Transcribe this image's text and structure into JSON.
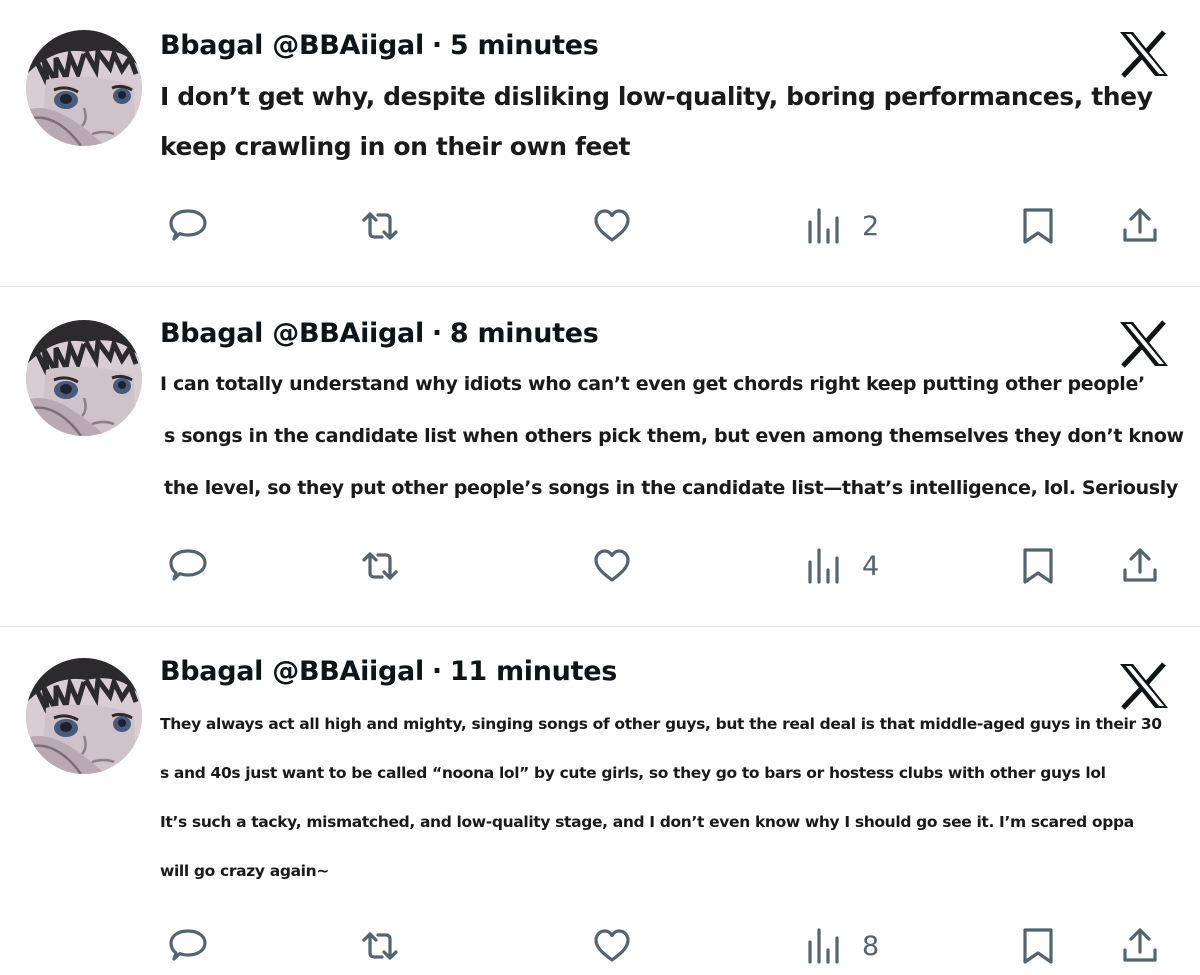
{
  "tweets": [
    {
      "display_name": "Bbagal",
      "handle": "@BBAiigal",
      "separator": "·",
      "time": "5 minutes",
      "lines": [
        "I don’t get why, despite disliking low-quality, boring performances, they",
        "keep crawling in on their own feet"
      ],
      "views": "2"
    },
    {
      "display_name": "Bbagal",
      "handle": "@BBAiigal",
      "separator": "·",
      "time": "8 minutes",
      "lines": [
        "I can totally understand why idiots who can’t even get chords right keep putting other people’",
        "s songs in the candidate list when others pick them, but even among themselves they don’t know",
        "the level, so they put other people’s songs in the candidate list—that’s intelligence, lol. Seriously"
      ],
      "views": "4"
    },
    {
      "display_name": "Bbagal",
      "handle": "@BBAiigal",
      "separator": "·",
      "time": "11 minutes",
      "lines": [
        "They always act all high and mighty, singing songs of other guys, but the real deal is that middle-aged guys in their 30",
        "s and 40s just want to be called “noona lol” by cute girls, so they go to bars or hostess clubs with other guys lol",
        "It’s such a tacky, mismatched, and low-quality stage, and I don’t even know why I should go see it. I’m scared oppa",
        "will go crazy again~"
      ],
      "views": "8"
    }
  ],
  "icons": {
    "logo": "x-logo-icon",
    "reply": "reply-icon",
    "retweet": "retweet-icon",
    "like": "heart-icon",
    "views": "views-chart-icon",
    "bookmark": "bookmark-icon",
    "share": "share-icon"
  },
  "colors": {
    "icon_gray": "#536471",
    "text": "#0f1419",
    "divider": "#e6e8ea"
  }
}
